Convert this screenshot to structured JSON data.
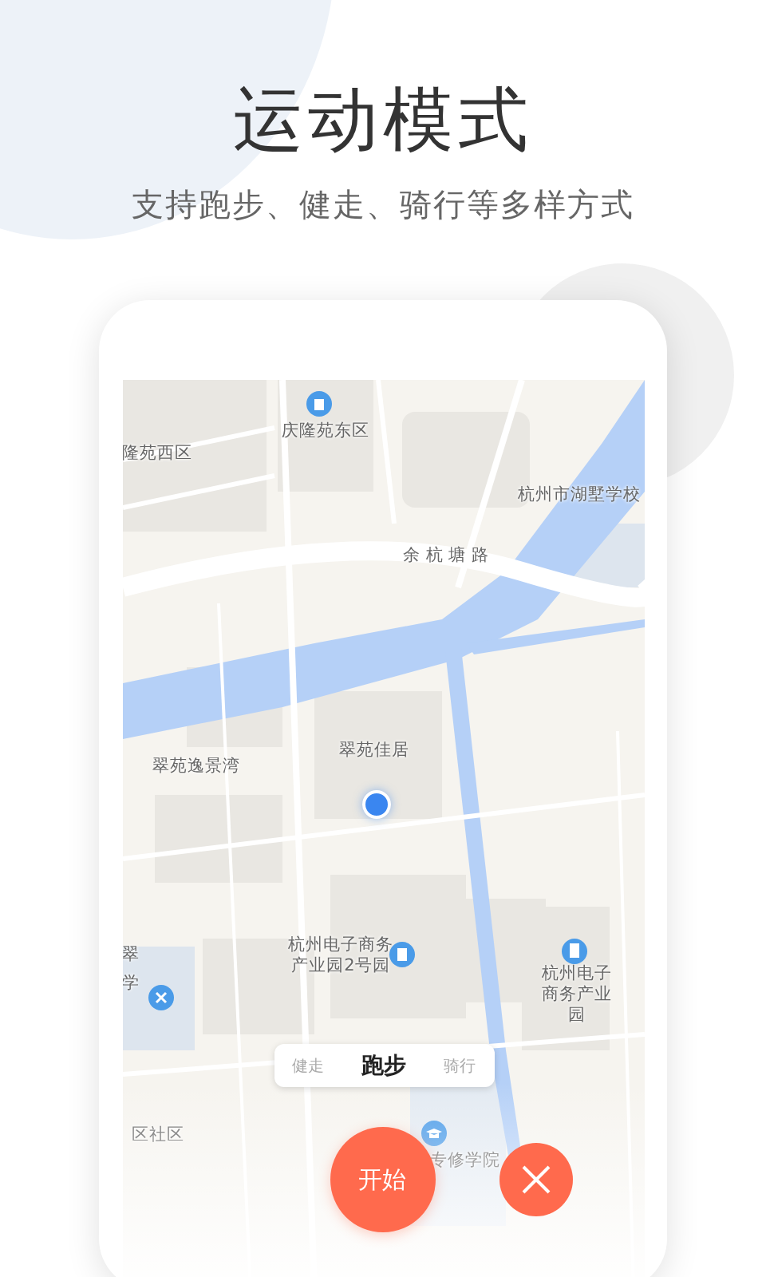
{
  "header": {
    "title": "运动模式",
    "subtitle": "支持跑步、健走、骑行等多样方式"
  },
  "map": {
    "labels": [
      {
        "text": "庆隆苑东区"
      },
      {
        "text": "隆苑西区"
      },
      {
        "text": "杭州市湖墅学校"
      },
      {
        "text": "余 杭 塘 路"
      },
      {
        "text": "翠苑逸景湾"
      },
      {
        "text": "翠苑佳居"
      },
      {
        "text": "杭州电子商务产业园2号园"
      },
      {
        "text": "杭州电子商务产业园"
      },
      {
        "text": "翠"
      },
      {
        "text": "学"
      },
      {
        "text": "区社区"
      },
      {
        "text": "专修学院"
      }
    ]
  },
  "modes": [
    {
      "label": "健走",
      "selected": false
    },
    {
      "label": "跑步",
      "selected": true
    },
    {
      "label": "骑行",
      "selected": false
    }
  ],
  "start_button": "开始"
}
